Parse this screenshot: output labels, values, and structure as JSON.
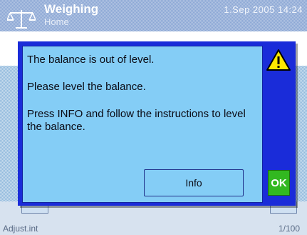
{
  "header": {
    "title": "Weighing",
    "subtitle": "Home",
    "datetime": "1.Sep 2005  14:24",
    "icon": "balance-scale-icon"
  },
  "footer": {
    "left_label": "Adjust.int",
    "right_label": "1/100"
  },
  "dialog": {
    "message_1": "The balance is out of level.",
    "message_2": "Please level the balance.",
    "message_3": "Press INFO and follow the instructions to level the balance.",
    "info_button_label": "Info",
    "ok_button_label": "OK",
    "icon": "warning-icon"
  },
  "colors": {
    "dialog_frame": "#1a2cd9",
    "dialog_body": "#84cdf6",
    "ok_button": "#32b820",
    "warning_yellow": "#ffe800"
  }
}
